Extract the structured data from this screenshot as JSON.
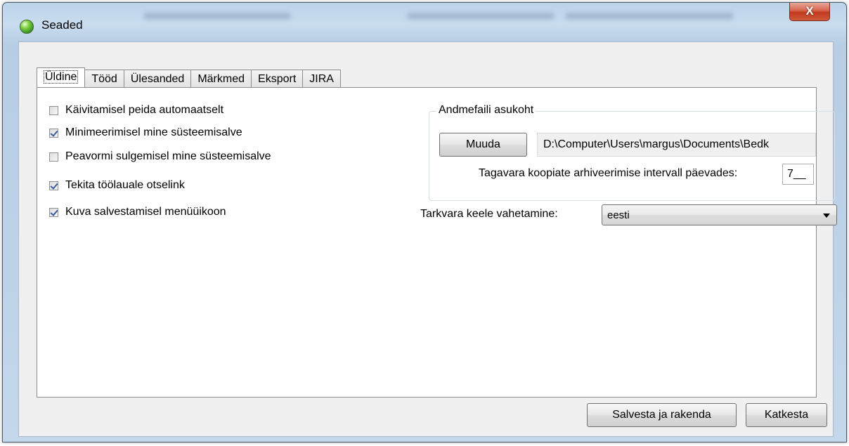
{
  "window": {
    "title": "Seaded",
    "close_glyph": "X"
  },
  "tabs": [
    {
      "label": "Üldine",
      "active": true
    },
    {
      "label": "Tööd",
      "active": false
    },
    {
      "label": "Ülesanded",
      "active": false
    },
    {
      "label": "Märkmed",
      "active": false
    },
    {
      "label": "Eksport",
      "active": false
    },
    {
      "label": "JIRA",
      "active": false
    }
  ],
  "general": {
    "checkboxes": [
      {
        "label": "Käivitamisel peida automaatselt",
        "checked": false
      },
      {
        "label": "Minimeerimisel mine süsteemisalve",
        "checked": true
      },
      {
        "label": "Peavormi sulgemisel mine süsteemisalve",
        "checked": false
      },
      {
        "label": "Tekita töölauale otselink",
        "checked": true
      },
      {
        "label": "Kuva salvestamisel menüüikoon",
        "checked": true
      }
    ],
    "data_file": {
      "group_title": "Andmefaili asukoht",
      "change_button": "Muuda",
      "path_value": "D:\\Computer\\Users\\margus\\Documents\\Bedk",
      "interval_label": "Tagavara koopiate arhiveerimise intervall päevades:",
      "interval_value": "7__"
    },
    "language": {
      "label": "Tarkvara keele vahetamine:",
      "selected": "eesti"
    }
  },
  "footer": {
    "save_label": "Salvesta ja rakenda",
    "cancel_label": "Katkesta"
  },
  "icons": {
    "app": "green-orb-icon",
    "dropdown": "chevron-down-icon"
  }
}
